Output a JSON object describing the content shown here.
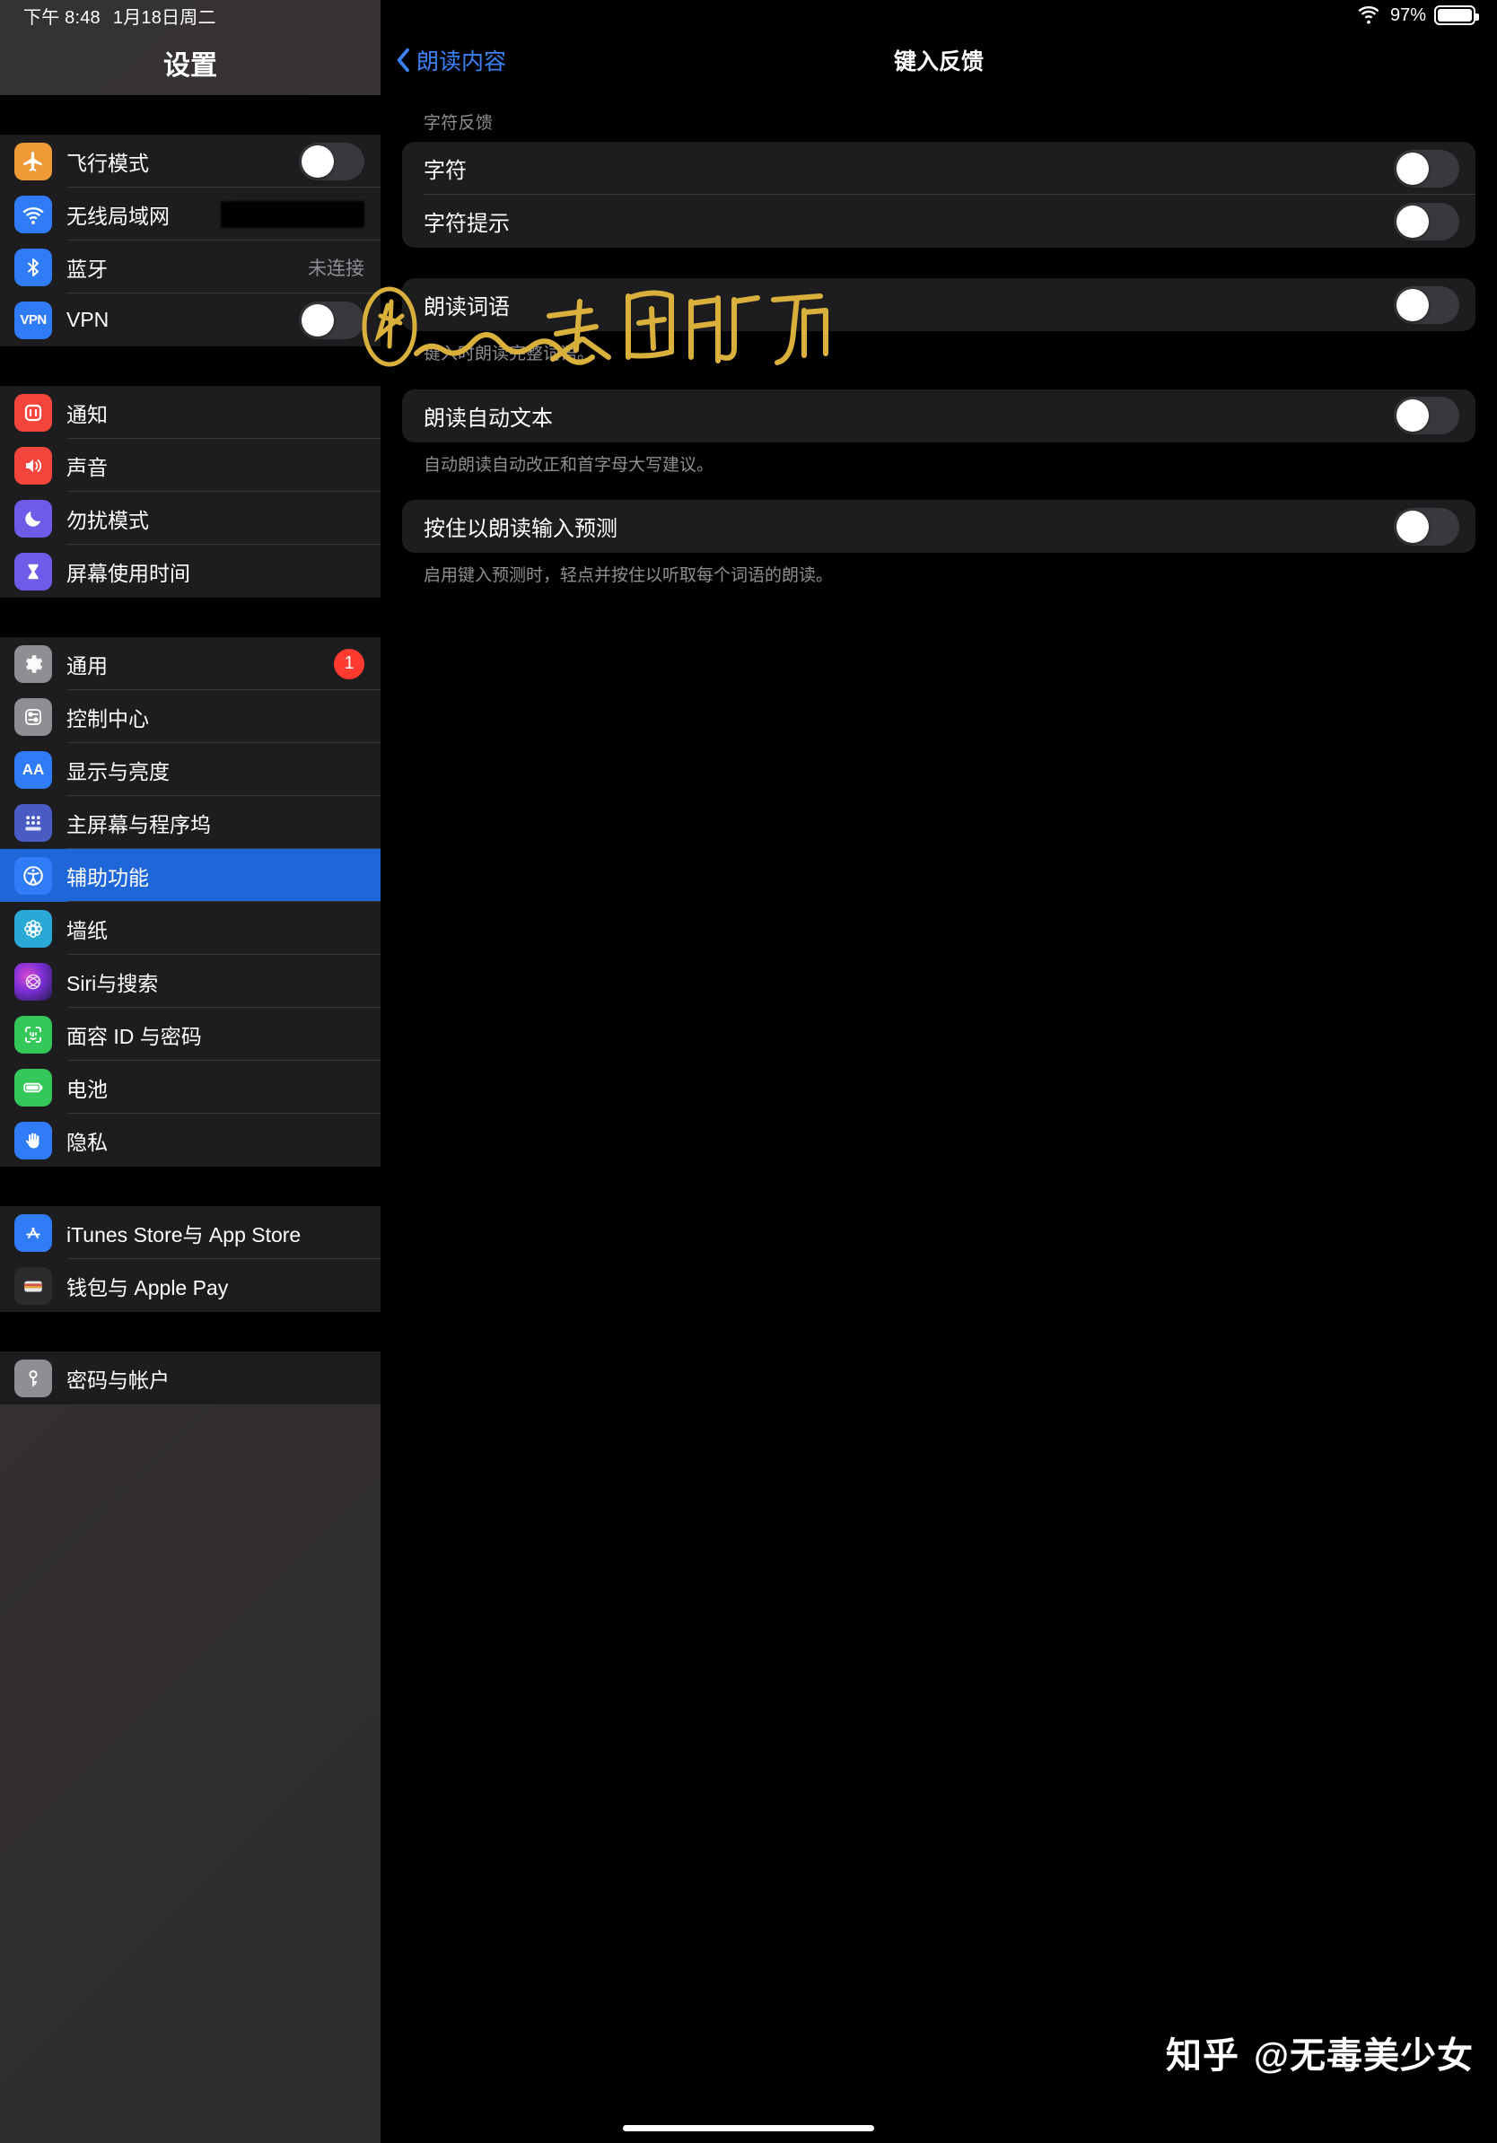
{
  "status_bar": {
    "time": "下午 8:48",
    "date": "1月18日周二",
    "wifi_icon": "wifi-icon",
    "battery_percent": "97%",
    "battery_icon": "battery-full-icon"
  },
  "sidebar": {
    "title": "设置",
    "groups": [
      {
        "items": [
          {
            "label": "飞行模式",
            "icon": "airplane-icon",
            "icon_color": "#f09a37",
            "accessory": "switch",
            "switch_on": false
          },
          {
            "label": "无线局域网",
            "icon": "wifi-icon",
            "icon_color": "#2f7cf6",
            "accessory": "redacted"
          },
          {
            "label": "蓝牙",
            "icon": "bluetooth-icon",
            "icon_color": "#2f7cf6",
            "accessory": "value",
            "value": "未连接"
          },
          {
            "label": "VPN",
            "icon": "vpn-icon",
            "icon_color": "#2f7cf6",
            "accessory": "switch",
            "switch_on": false
          }
        ]
      },
      {
        "items": [
          {
            "label": "通知",
            "icon": "notifications-icon",
            "icon_color": "#f4453c",
            "accessory": "none"
          },
          {
            "label": "声音",
            "icon": "sound-icon",
            "icon_color": "#f4453c",
            "accessory": "none"
          },
          {
            "label": "勿扰模式",
            "icon": "moon-icon",
            "icon_color": "#6c5ce7",
            "accessory": "none"
          },
          {
            "label": "屏幕使用时间",
            "icon": "hourglass-icon",
            "icon_color": "#6c5ce7",
            "accessory": "none"
          }
        ]
      },
      {
        "items": [
          {
            "label": "通用",
            "icon": "gear-icon",
            "icon_color": "#8e8e93",
            "accessory": "badge",
            "badge": "1"
          },
          {
            "label": "控制中心",
            "icon": "control-center-icon",
            "icon_color": "#8e8e93",
            "accessory": "none"
          },
          {
            "label": "显示与亮度",
            "icon": "display-icon",
            "icon_color": "#2f7cf6",
            "accessory": "none"
          },
          {
            "label": "主屏幕与程序坞",
            "icon": "home-screen-icon",
            "icon_color": "#4a5bc4",
            "accessory": "none"
          },
          {
            "label": "辅助功能",
            "icon": "accessibility-icon",
            "icon_color": "#2f7cf6",
            "accessory": "none",
            "selected": true
          },
          {
            "label": "墙纸",
            "icon": "wallpaper-icon",
            "icon_color": "#2aa9d6",
            "accessory": "none"
          },
          {
            "label": "Siri与搜索",
            "icon": "siri-icon",
            "icon_color": "#2b2b4a",
            "accessory": "none"
          },
          {
            "label": "面容 ID 与密码",
            "icon": "face-id-icon",
            "icon_color": "#34c759",
            "accessory": "none"
          },
          {
            "label": "电池",
            "icon": "battery-icon",
            "icon_color": "#34c759",
            "accessory": "none"
          },
          {
            "label": "隐私",
            "icon": "privacy-hand-icon",
            "icon_color": "#2f7cf6",
            "accessory": "none"
          }
        ]
      },
      {
        "items": [
          {
            "label": "iTunes Store与 App Store",
            "icon": "app-store-icon",
            "icon_color": "#2f7cf6",
            "accessory": "none"
          },
          {
            "label": "钱包与 Apple Pay",
            "icon": "wallet-icon",
            "icon_color": "#2b2b2d",
            "accessory": "none"
          }
        ]
      },
      {
        "items": [
          {
            "label": "密码与帐户",
            "icon": "key-icon",
            "icon_color": "#8e8e93",
            "accessory": "none"
          }
        ]
      }
    ]
  },
  "detail": {
    "back_label": "朗读内容",
    "back_icon": "chevron-left-icon",
    "title": "键入反馈",
    "section1_header": "字符反馈",
    "rows": [
      {
        "label": "字符",
        "switch_on": false
      },
      {
        "label": "字符提示",
        "switch_on": false
      },
      {
        "label": "朗读词语",
        "switch_on": false,
        "footnote": "键入时朗读完整词语。"
      },
      {
        "label": "朗读自动文本",
        "switch_on": false,
        "footnote": "自动朗读自动改正和首字母大写建议。"
      },
      {
        "label": "按住以朗读输入预测",
        "switch_on": false,
        "footnote": "启用键入预测时，轻点并按住以听取每个词语的朗读。"
      }
    ]
  },
  "annotation": {
    "handwritten_text": "关闭即可",
    "marker_number": "4",
    "color": "#d9b03c"
  },
  "watermark": {
    "logo": "知乎",
    "handle": "@无毒美少女"
  }
}
